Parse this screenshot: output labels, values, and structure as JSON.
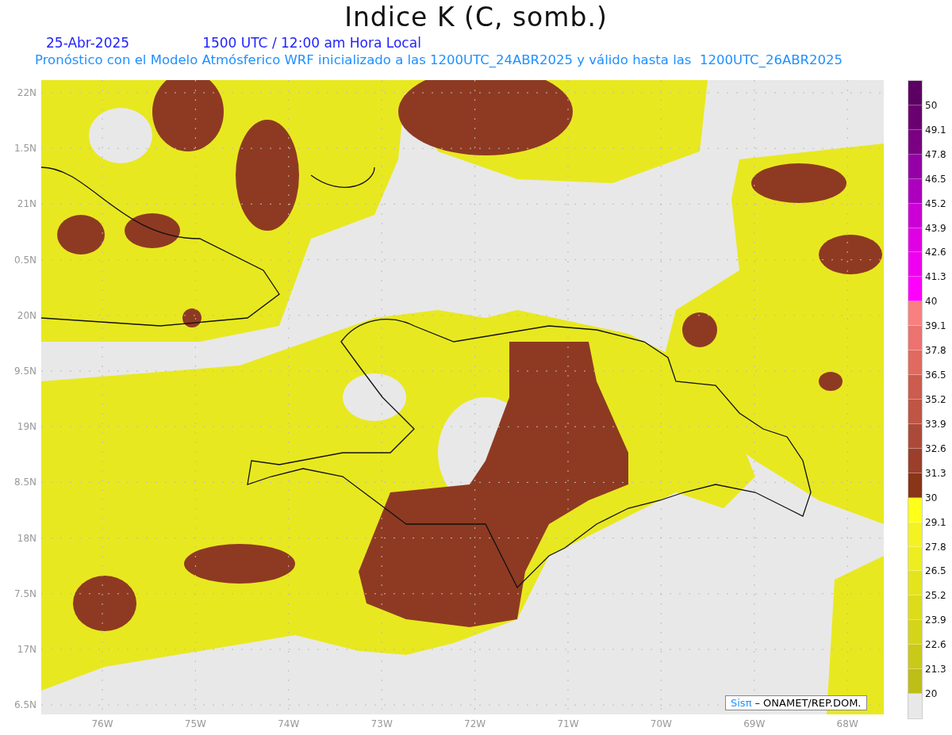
{
  "title": "Indice K (C, somb.)",
  "date": "25-Abr-2025",
  "time": "1500 UTC / 12:00 am Hora Local",
  "subtitle": "Pronóstico con el Modelo Atmósferico WRF inicializado a las 1200UTC_24ABR2025 y válido hasta las  1200UTC_26ABR2025",
  "lat_labels": [
    "22N",
    "1.5N",
    "21N",
    "0.5N",
    "20N",
    "9.5N",
    "19N",
    "8.5N",
    "18N",
    "7.5N",
    "17N",
    "6.5N"
  ],
  "lon_labels": [
    "76W",
    "75W",
    "74W",
    "73W",
    "72W",
    "71W",
    "70W",
    "69W",
    "68W"
  ],
  "credit": {
    "logo": "Sisπ",
    "text": "– ONAMET/REP.DOM."
  },
  "legend": [
    {
      "color": "#5c0063",
      "label": "50"
    },
    {
      "color": "#6a0070",
      "label": "49.1"
    },
    {
      "color": "#7a0082",
      "label": "47.8"
    },
    {
      "color": "#9400a6",
      "label": "46.5"
    },
    {
      "color": "#ad00bf",
      "label": "45.2"
    },
    {
      "color": "#cb00d6",
      "label": "43.9"
    },
    {
      "color": "#e000e4",
      "label": "42.6"
    },
    {
      "color": "#ef00f0",
      "label": "41.3"
    },
    {
      "color": "#ff00ff",
      "label": "40"
    },
    {
      "color": "#f88080",
      "label": "39.1"
    },
    {
      "color": "#ec7270",
      "label": "37.8"
    },
    {
      "color": "#e06a60",
      "label": "36.5"
    },
    {
      "color": "#cc5c4e",
      "label": "35.2"
    },
    {
      "color": "#bf5545",
      "label": "33.9"
    },
    {
      "color": "#ac4a3a",
      "label": "32.6"
    },
    {
      "color": "#9c3e2c",
      "label": "31.3"
    },
    {
      "color": "#8a3418",
      "label": "30"
    },
    {
      "color": "#ffff1a",
      "label": "29.1"
    },
    {
      "color": "#f4f220",
      "label": "27.8"
    },
    {
      "color": "#eded20",
      "label": "26.5"
    },
    {
      "color": "#e4e41c",
      "label": "25.2"
    },
    {
      "color": "#dcdc1a",
      "label": "23.9"
    },
    {
      "color": "#d4d41a",
      "label": "22.6"
    },
    {
      "color": "#c9c918",
      "label": "21.3"
    },
    {
      "color": "#bebe18",
      "label": "20"
    },
    {
      "color": "#e8e8e8"
    }
  ]
}
